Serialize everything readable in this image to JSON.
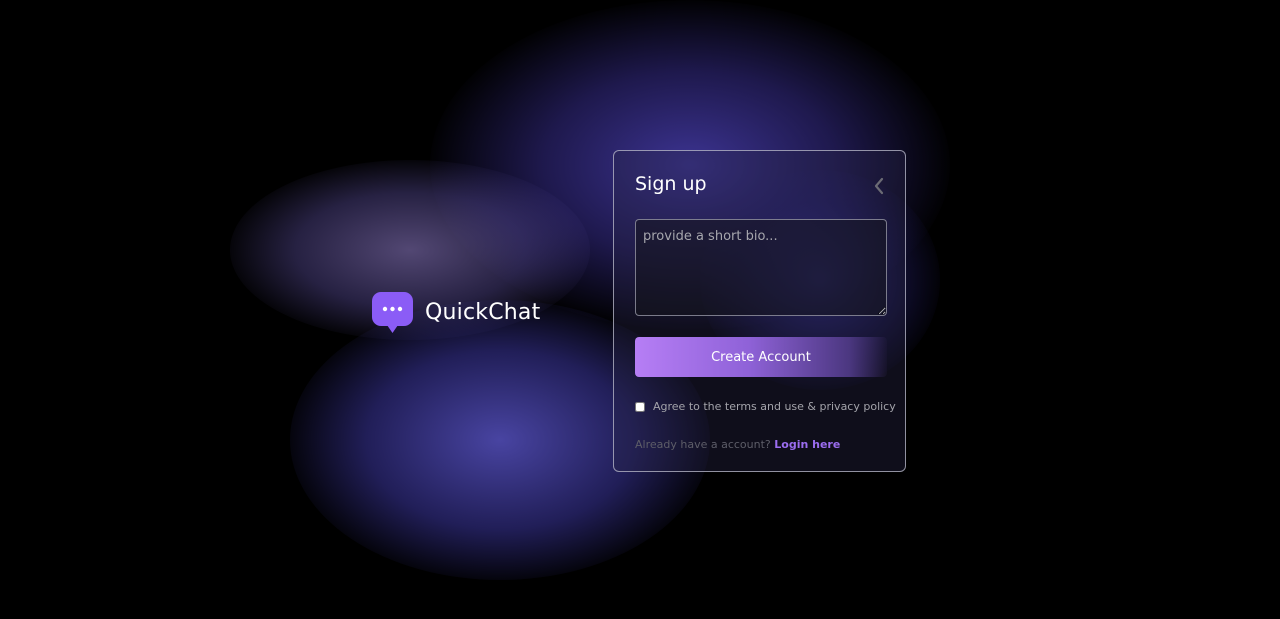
{
  "brand": {
    "name": "QuickChat",
    "icon": "chat-bubble-icon",
    "accent": "#8b5cf6"
  },
  "signup": {
    "title": "Sign up",
    "back_icon": "chevron-left-icon",
    "bio": {
      "placeholder": "provide a short bio...",
      "value": ""
    },
    "create_button_label": "Create Account",
    "terms_label": "Agree to the terms and use & privacy policy",
    "terms_checked": false,
    "login_prompt": "Already have a account?",
    "login_link": "Login here"
  },
  "colors": {
    "background": "#000000",
    "button_gradient_start": "#b67ef5",
    "link": "#9b6df0"
  }
}
